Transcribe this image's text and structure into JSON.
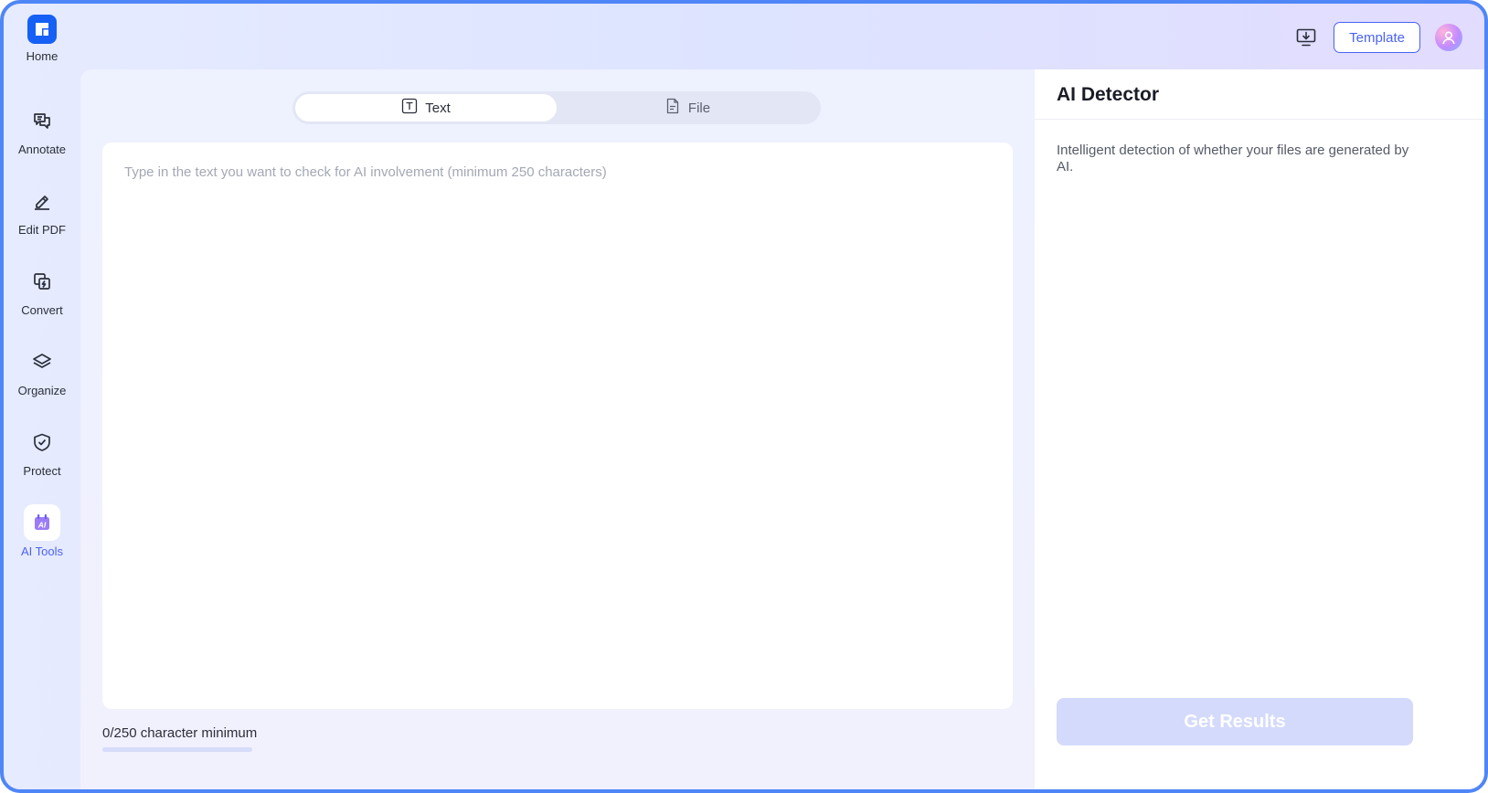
{
  "sidebar": {
    "home_label": "Home",
    "items": [
      {
        "label": "Annotate",
        "icon": "annotate-icon"
      },
      {
        "label": "Edit PDF",
        "icon": "edit-pdf-icon"
      },
      {
        "label": "Convert",
        "icon": "convert-icon"
      },
      {
        "label": "Organize",
        "icon": "organize-icon"
      },
      {
        "label": "Protect",
        "icon": "protect-icon"
      },
      {
        "label": "AI Tools",
        "icon": "ai-tools-icon",
        "active": true
      }
    ]
  },
  "topbar": {
    "template_label": "Template",
    "install_icon": "desktop-download-icon",
    "avatar_icon": "user-avatar-icon"
  },
  "main": {
    "tabs": [
      {
        "label": "Text",
        "icon": "text-icon",
        "active": true
      },
      {
        "label": "File",
        "icon": "file-icon",
        "active": false
      }
    ],
    "input": {
      "value": "",
      "placeholder": "Type in the text you want to check for AI involvement (minimum 250 characters)"
    },
    "counter_text": "0/250 character minimum",
    "progress_fraction": 0
  },
  "panel": {
    "title": "AI Detector",
    "description": "Intelligent detection of whether your files are generated by AI.",
    "button_label": "Get Results"
  },
  "colors": {
    "accent": "#4b63f0",
    "logo": "#1660f5",
    "frame_border": "#4f86f7",
    "button_disabled": "#d4dafb"
  }
}
